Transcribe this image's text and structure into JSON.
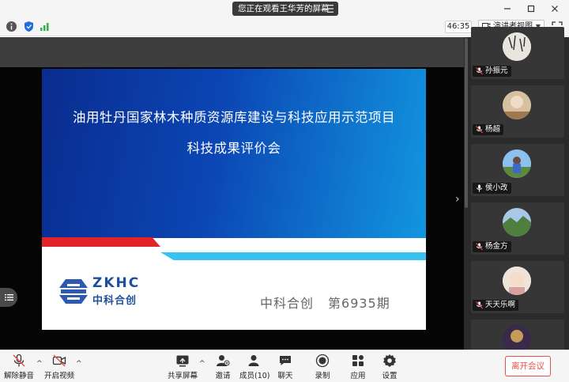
{
  "titlebar": {
    "share_notice": "您正在观看王华芳的屏幕"
  },
  "infobar": {
    "timer": "46:35",
    "view_mode": "演讲者视图"
  },
  "slide": {
    "title_line1": "油用牡丹国家林木种质资源库建设与科技应用示范项目",
    "title_line2": "科技成果评价会",
    "logo_en": "ZKHC",
    "logo_cn": "中科合创",
    "footer_org": "中科合创",
    "footer_issue": "第6935期"
  },
  "participants": [
    {
      "name": "孙振元",
      "icon": "mic-muted-icon"
    },
    {
      "name": "杨超",
      "icon": "mic-muted-icon"
    },
    {
      "name": "侯小改",
      "icon": "mic-icon"
    },
    {
      "name": "杨金方",
      "icon": "mic-muted-icon"
    },
    {
      "name": "天天乐啊",
      "icon": "mic-muted-icon"
    }
  ],
  "toolbar": {
    "unmute": "解除静音",
    "start_video": "开启视频",
    "share_screen": "共享屏幕",
    "invite": "邀请",
    "members": "成员(10)",
    "chat": "聊天",
    "record": "录制",
    "apps": "应用",
    "settings": "设置",
    "leave": "离开会议"
  },
  "colors": {
    "slide_blue_dark": "#0a2c8f",
    "slide_blue_light": "#1296e0",
    "slide_red": "#e3232a",
    "slide_cyan": "#39c2ef",
    "leave_red": "#e5504a",
    "logo_blue": "#1f4f9c"
  }
}
